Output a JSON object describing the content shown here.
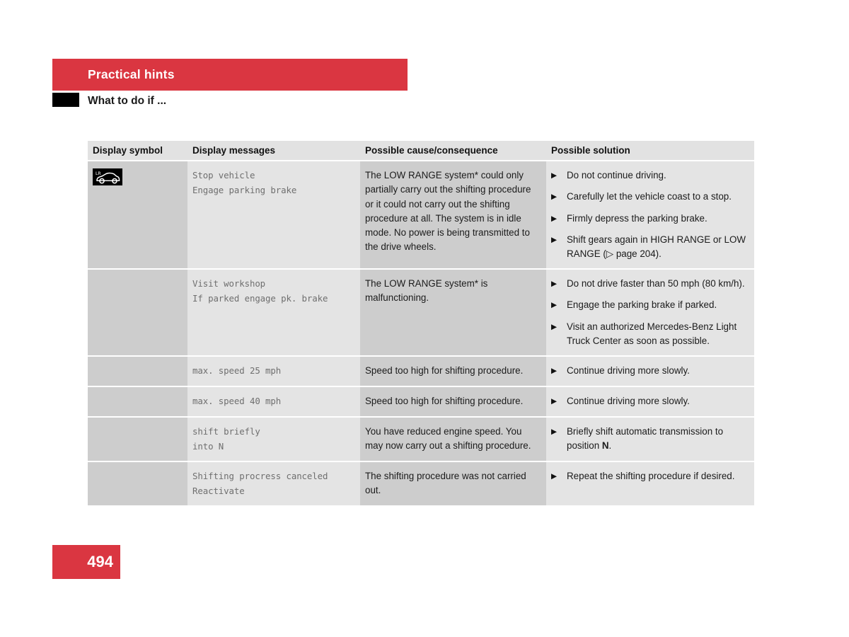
{
  "header": {
    "chapter_title": "Practical hints",
    "section_title": "What to do if ..."
  },
  "table": {
    "columns": [
      "Display symbol",
      "Display messages",
      "Possible cause/consequence",
      "Possible solution"
    ],
    "rows": [
      {
        "symbol": "low-range-vehicle-indicator",
        "symbol_label": "LR",
        "message": "Stop vehicle\nEngage parking brake",
        "cause": "The LOW RANGE system* could only partially carry out the shifting procedure or it could not carry out the shifting procedure at all. The system is in idle mode. No power is being transmitted to the drive wheels.",
        "solutions": [
          "Do not continue driving.",
          "Carefully let the vehicle coast to a stop.",
          "Firmly depress the parking brake.",
          "Shift gears again in HIGH RANGE or LOW RANGE (▷ page 204)."
        ]
      },
      {
        "symbol": "",
        "message": "Visit workshop\nIf parked engage pk. brake",
        "cause": "The LOW RANGE system* is malfunctioning.",
        "solutions": [
          "Do not drive faster than 50 mph (80 km/h).",
          "Engage the parking brake if parked.",
          "Visit an authorized Mercedes-Benz Light Truck Center as soon as possible."
        ]
      },
      {
        "symbol": "",
        "message": "max. speed 25 mph",
        "cause": "Speed too high for shifting procedure.",
        "solutions": [
          "Continue driving more slowly."
        ]
      },
      {
        "symbol": "",
        "message": "max. speed 40 mph",
        "cause": "Speed too high for shifting procedure.",
        "solutions": [
          "Continue driving more slowly."
        ]
      },
      {
        "symbol": "",
        "message": "shift briefly\ninto N",
        "cause": "You have reduced engine speed. You may now carry out a shifting procedure.",
        "solutions_html": [
          "Briefly shift automatic transmission to position <b>N</b>."
        ],
        "solutions": [
          "Briefly shift automatic transmission to position N."
        ]
      },
      {
        "symbol": "",
        "message": "Shifting procress canceled\nReactivate",
        "cause": "The shifting procedure was not carried out.",
        "solutions": [
          "Repeat the shifting procedure if desired."
        ]
      }
    ],
    "bullet_glyph": "▶"
  },
  "footer": {
    "page_number": "494"
  },
  "colors": {
    "accent_red": "#da3641",
    "symbol_col_bg": "#cdcdcd",
    "message_col_bg": "#e4e4e4",
    "header_row_bg": "#e2e2e2",
    "message_text": "#6f6f6f"
  }
}
